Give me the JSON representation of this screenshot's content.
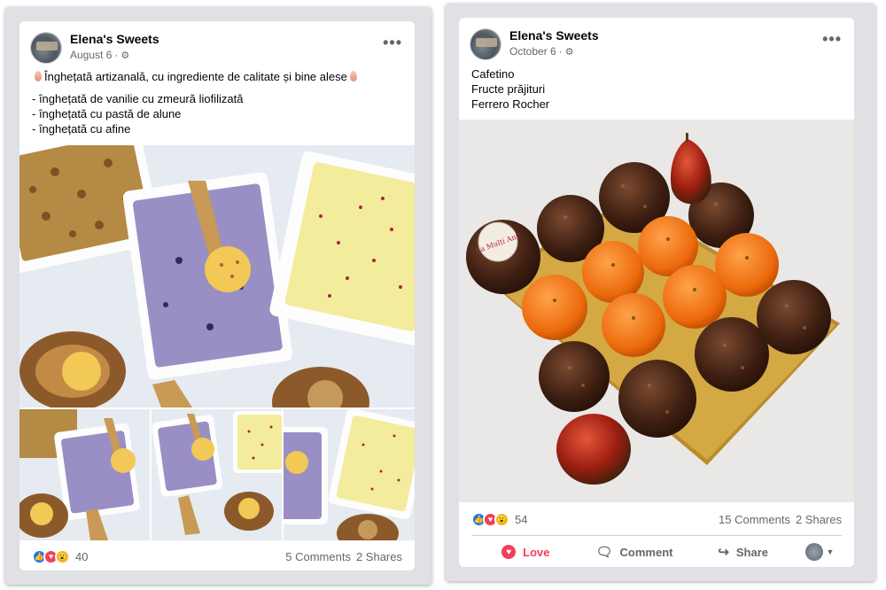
{
  "posts": [
    {
      "page_name": "Elena's Sweets",
      "date": "August 6",
      "meta_separator": "·",
      "privacy_icon": "gear-icon",
      "text_lines": [
        "Înghețată artizanală, cu ingrediente de calitate și bine alese",
        "- înghețată de vanilie cu zmeură liofilizată",
        "- înghețată cu pastă de alune",
        "- înghețată cu afine"
      ],
      "reaction_count": "40",
      "comments": "5 Comments",
      "shares": "2 Shares"
    },
    {
      "page_name": "Elena's Sweets",
      "date": "October 6",
      "meta_separator": "·",
      "privacy_icon": "gear-icon",
      "text_lines": [
        "Cafetino",
        "Fructe prăjituri",
        "Ferrero Rocher"
      ],
      "reaction_count": "54",
      "comments": "15 Comments",
      "shares": "2 Shares",
      "actions": {
        "love": "Love",
        "comment": "Comment",
        "share": "Share"
      }
    }
  ],
  "photo_text": "La Mulți Ani!",
  "colors": {
    "facebook_blue": "#1877f2",
    "love_red": "#f33e58",
    "wow_yellow": "#f7b125",
    "secondary_text": "#65676b"
  }
}
